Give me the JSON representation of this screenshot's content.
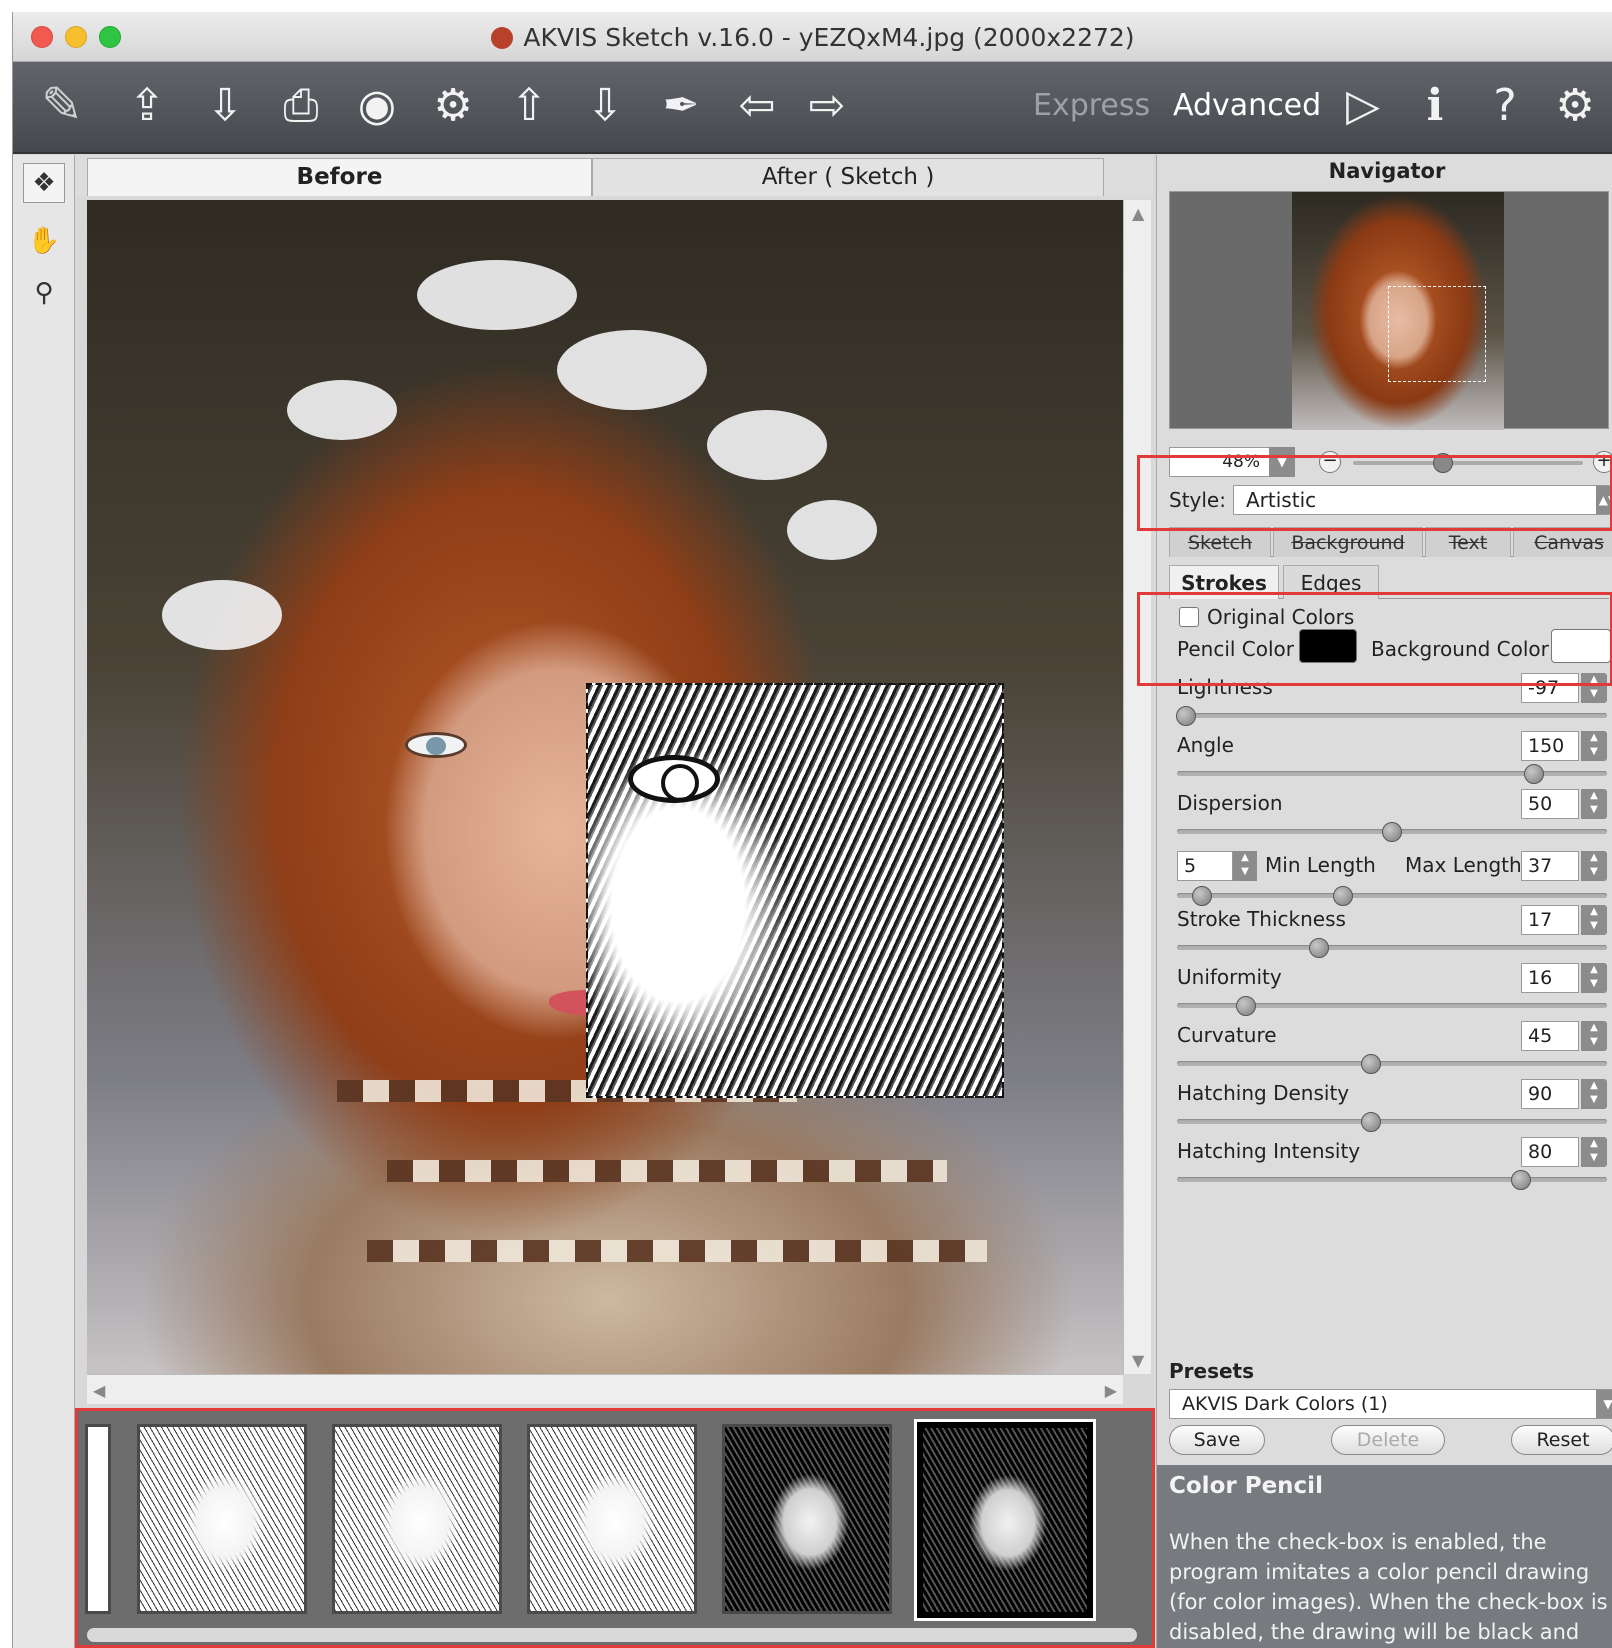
{
  "window": {
    "title": "AKVIS Sketch v.16.0 - yEZQxM4.jpg (2000x2272)"
  },
  "toolbar": {
    "icons": [
      "app-logo-icon",
      "open-icon",
      "save-icon",
      "print-icon",
      "share-icon",
      "batch-icon",
      "import-preset-icon",
      "export-preset-icon",
      "eraser-icon",
      "undo-icon",
      "redo-icon"
    ],
    "mode_express": "Express",
    "mode_advanced": "Advanced",
    "right_icons": [
      "run-icon",
      "info-icon",
      "help-icon",
      "settings-icon"
    ]
  },
  "image_tabs": {
    "before": "Before",
    "after": "After ( Sketch )"
  },
  "tools": [
    "before-after-tool-icon",
    "hand-tool-icon",
    "zoom-tool-icon"
  ],
  "navigator": {
    "title": "Navigator",
    "zoom": "48%"
  },
  "settings": {
    "style_label": "Style:",
    "style_value": "Artistic",
    "subtabs": [
      "Sketch",
      "Background",
      "Text",
      "Canvas"
    ],
    "stroke_tabs": [
      "Strokes",
      "Edges"
    ],
    "original_colors": "Original Colors",
    "pencil_color_label": "Pencil Color",
    "background_color_label": "Background Color",
    "pencil_color": "#000000",
    "background_color": "#ffffff",
    "params": [
      {
        "name": "Lightness",
        "value": "-97",
        "fraction": 0.02
      },
      {
        "name": "Angle",
        "value": "150",
        "fraction": 0.83
      },
      {
        "name": "Dispersion",
        "value": "50",
        "fraction": 0.5
      },
      {
        "name": "Stroke Thickness",
        "value": "17",
        "fraction": 0.33
      },
      {
        "name": "Uniformity",
        "value": "16",
        "fraction": 0.16
      },
      {
        "name": "Curvature",
        "value": "45",
        "fraction": 0.45
      },
      {
        "name": "Hatching Density",
        "value": "90",
        "fraction": 0.45
      },
      {
        "name": "Hatching Intensity",
        "value": "80",
        "fraction": 0.8
      }
    ],
    "min_length_value": "5",
    "min_length_label": "Min Length",
    "max_length_label": "Max Length",
    "max_length_value": "37"
  },
  "presets": {
    "title": "Presets",
    "selected": "AKVIS Dark Colors (1)",
    "save": "Save",
    "delete": "Delete",
    "reset": "Reset"
  },
  "help": {
    "title": "Color Pencil",
    "body": "When the check-box is enabled, the program imitates a color pencil drawing (for color images). When the check-box is disabled, the drawing will be black and white."
  },
  "colors": {
    "highlight": "#e03a3a"
  }
}
